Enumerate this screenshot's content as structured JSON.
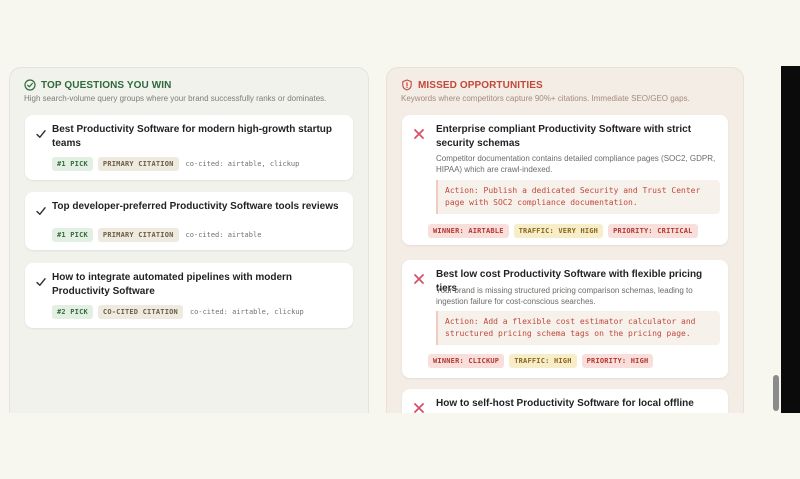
{
  "wins": {
    "title": "TOP QUESTIONS YOU WIN",
    "subtitle": "High search-volume query groups where your brand successfully ranks or dominates.",
    "icon": "check-circle-icon",
    "accent": "#2f6a3d",
    "items": [
      {
        "question": "Best Productivity Software for modern high-growth startup teams",
        "rank": "#1 PICK",
        "citation": "PRIMARY CITATION",
        "cocited": "co-cited: airtable, clickup"
      },
      {
        "question": "Top developer-preferred Productivity Software tools reviews",
        "rank": "#1 PICK",
        "citation": "PRIMARY CITATION",
        "cocited": "co-cited: airtable"
      },
      {
        "question": "How to integrate automated pipelines with modern Productivity Software",
        "rank": "#2 PICK",
        "citation": "CO-CITED CITATION",
        "cocited": "co-cited: airtable, clickup"
      }
    ]
  },
  "missed": {
    "title": "MISSED OPPORTUNITIES",
    "subtitle": "Keywords where competitors capture 90%+ citations. Immediate SEO/GEO gaps.",
    "icon": "shield-alert-icon",
    "accent": "#c2483b",
    "items": [
      {
        "question": "Enterprise compliant Productivity Software with strict security schemas",
        "description": "Competitor documentation contains detailed compliance pages (SOC2, GDPR, HIPAA) which are crawl-indexed.",
        "action": "Action: Publish a dedicated Security and Trust Center page with SOC2 compliance documentation.",
        "winner": "WINNER: AIRTABLE",
        "traffic": "TRAFFIC: VERY HIGH",
        "priority": "PRIORITY: CRITICAL"
      },
      {
        "question": "Best low cost Productivity Software with flexible pricing tiers",
        "description": "Your brand is missing structured pricing comparison schemas, leading to ingestion failure for cost-conscious searches.",
        "action": "Action: Add a flexible cost estimator calculator and structured pricing schema tags on the pricing page.",
        "winner": "WINNER: CLICKUP",
        "traffic": "TRAFFIC: HIGH",
        "priority": "PRIORITY: HIGH"
      },
      {
        "question": "How to self-host Productivity Software for local offline"
      }
    ]
  }
}
